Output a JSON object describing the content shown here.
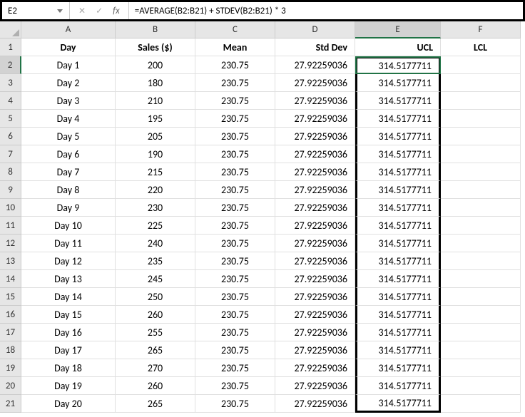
{
  "nameBox": "E2",
  "formula": "=AVERAGE(B2:B21) + STDEV(B2:B21) * 3",
  "colLetters": [
    "A",
    "B",
    "C",
    "D",
    "E",
    "F"
  ],
  "selectedCol": "E",
  "selectedRow": 2,
  "headers": {
    "A": "Day",
    "B": "Sales ($)",
    "C": "Mean",
    "D": "Std Dev",
    "E": "UCL",
    "F": "LCL"
  },
  "chart_data": {
    "type": "table",
    "title": "Sales control chart data",
    "columns": [
      "Day",
      "Sales ($)",
      "Mean",
      "Std Dev",
      "UCL",
      "LCL"
    ],
    "rows": [
      {
        "Day": "Day 1",
        "Sales": 200,
        "Mean": 230.75,
        "StdDev": 27.92259036,
        "UCL": 314.5177711,
        "LCL": ""
      },
      {
        "Day": "Day 2",
        "Sales": 180,
        "Mean": 230.75,
        "StdDev": 27.92259036,
        "UCL": 314.5177711,
        "LCL": ""
      },
      {
        "Day": "Day 3",
        "Sales": 210,
        "Mean": 230.75,
        "StdDev": 27.92259036,
        "UCL": 314.5177711,
        "LCL": ""
      },
      {
        "Day": "Day 4",
        "Sales": 195,
        "Mean": 230.75,
        "StdDev": 27.92259036,
        "UCL": 314.5177711,
        "LCL": ""
      },
      {
        "Day": "Day 5",
        "Sales": 205,
        "Mean": 230.75,
        "StdDev": 27.92259036,
        "UCL": 314.5177711,
        "LCL": ""
      },
      {
        "Day": "Day 6",
        "Sales": 190,
        "Mean": 230.75,
        "StdDev": 27.92259036,
        "UCL": 314.5177711,
        "LCL": ""
      },
      {
        "Day": "Day 7",
        "Sales": 215,
        "Mean": 230.75,
        "StdDev": 27.92259036,
        "UCL": 314.5177711,
        "LCL": ""
      },
      {
        "Day": "Day 8",
        "Sales": 220,
        "Mean": 230.75,
        "StdDev": 27.92259036,
        "UCL": 314.5177711,
        "LCL": ""
      },
      {
        "Day": "Day 9",
        "Sales": 230,
        "Mean": 230.75,
        "StdDev": 27.92259036,
        "UCL": 314.5177711,
        "LCL": ""
      },
      {
        "Day": "Day 10",
        "Sales": 225,
        "Mean": 230.75,
        "StdDev": 27.92259036,
        "UCL": 314.5177711,
        "LCL": ""
      },
      {
        "Day": "Day 11",
        "Sales": 240,
        "Mean": 230.75,
        "StdDev": 27.92259036,
        "UCL": 314.5177711,
        "LCL": ""
      },
      {
        "Day": "Day 12",
        "Sales": 235,
        "Mean": 230.75,
        "StdDev": 27.92259036,
        "UCL": 314.5177711,
        "LCL": ""
      },
      {
        "Day": "Day 13",
        "Sales": 245,
        "Mean": 230.75,
        "StdDev": 27.92259036,
        "UCL": 314.5177711,
        "LCL": ""
      },
      {
        "Day": "Day 14",
        "Sales": 250,
        "Mean": 230.75,
        "StdDev": 27.92259036,
        "UCL": 314.5177711,
        "LCL": ""
      },
      {
        "Day": "Day 15",
        "Sales": 260,
        "Mean": 230.75,
        "StdDev": 27.92259036,
        "UCL": 314.5177711,
        "LCL": ""
      },
      {
        "Day": "Day 16",
        "Sales": 255,
        "Mean": 230.75,
        "StdDev": 27.92259036,
        "UCL": 314.5177711,
        "LCL": ""
      },
      {
        "Day": "Day 17",
        "Sales": 265,
        "Mean": 230.75,
        "StdDev": 27.92259036,
        "UCL": 314.5177711,
        "LCL": ""
      },
      {
        "Day": "Day 18",
        "Sales": 270,
        "Mean": 230.75,
        "StdDev": 27.92259036,
        "UCL": 314.5177711,
        "LCL": ""
      },
      {
        "Day": "Day 19",
        "Sales": 260,
        "Mean": 230.75,
        "StdDev": 27.92259036,
        "UCL": 314.5177711,
        "LCL": ""
      },
      {
        "Day": "Day 20",
        "Sales": 265,
        "Mean": 230.75,
        "StdDev": 27.92259036,
        "UCL": 314.5177711,
        "LCL": ""
      }
    ]
  }
}
